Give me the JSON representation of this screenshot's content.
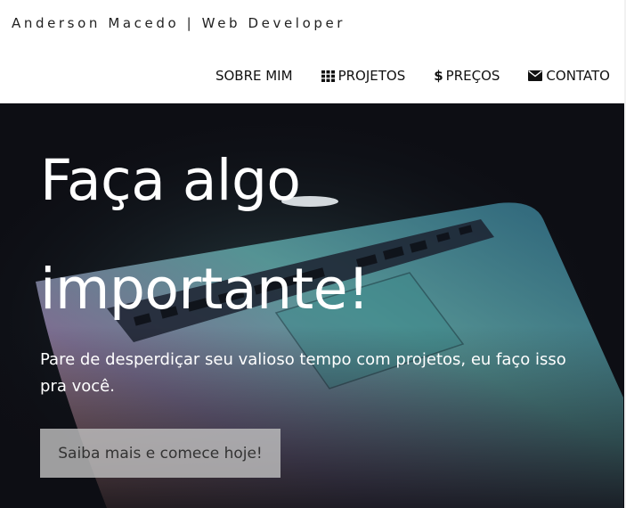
{
  "header": {
    "brand": "Anderson Macedo | Web Developer",
    "nav": [
      {
        "label": "SOBRE MIM",
        "icon": ""
      },
      {
        "label": "PROJETOS",
        "icon": "grid-icon"
      },
      {
        "label": "PREÇOS",
        "icon": "dollar-icon"
      },
      {
        "label": "CONTATO",
        "icon": "envelope-icon"
      }
    ]
  },
  "hero": {
    "headline_line1": "Faça algo",
    "headline_line2": "importante!",
    "subtitle": "Pare de desperdiçar seu valioso tempo com projetos, eu faço isso pra você.",
    "cta_label": "Saiba mais e comece hoje!"
  },
  "colors": {
    "hero_background": "#0d0e14",
    "cta_background": "#bebebe"
  }
}
